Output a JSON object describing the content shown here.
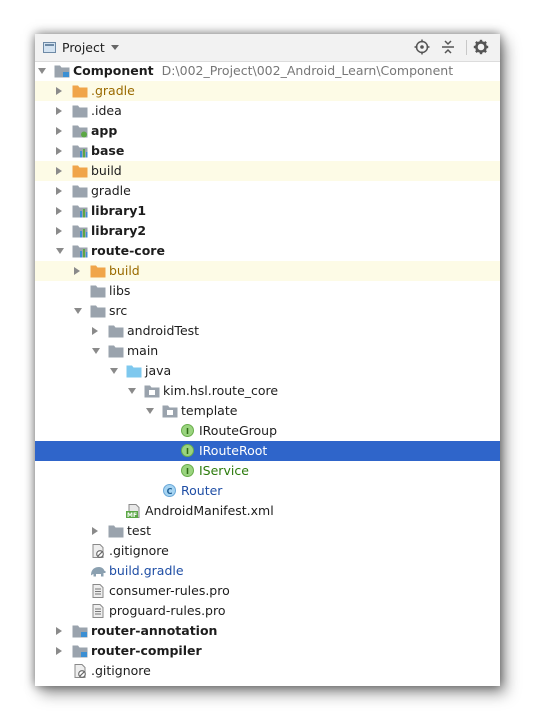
{
  "header": {
    "title": "Project",
    "buttons": [
      "locate-icon",
      "collapse-icon",
      "settings-icon"
    ]
  },
  "tree": [
    {
      "label": "Component",
      "path": "D:\\002_Project\\002_Android_Learn\\Component",
      "bold": true
    },
    {
      "label": ".gradle"
    },
    {
      "label": ".idea"
    },
    {
      "label": "app",
      "bold": true
    },
    {
      "label": "base",
      "bold": true
    },
    {
      "label": "build"
    },
    {
      "label": "gradle"
    },
    {
      "label": "library1",
      "bold": true
    },
    {
      "label": "library2",
      "bold": true
    },
    {
      "label": "route-core",
      "bold": true
    },
    {
      "label": "build"
    },
    {
      "label": "libs"
    },
    {
      "label": "src"
    },
    {
      "label": "androidTest"
    },
    {
      "label": "main"
    },
    {
      "label": "java"
    },
    {
      "label": "kim.hsl.route_core"
    },
    {
      "label": "template"
    },
    {
      "label": "IRouteGroup"
    },
    {
      "label": "IRouteRoot"
    },
    {
      "label": "IService"
    },
    {
      "label": "Router"
    },
    {
      "label": "AndroidManifest.xml"
    },
    {
      "label": "test"
    },
    {
      "label": ".gitignore"
    },
    {
      "label": "build.gradle"
    },
    {
      "label": "consumer-rules.pro"
    },
    {
      "label": "proguard-rules.pro"
    },
    {
      "label": "router-annotation",
      "bold": true
    },
    {
      "label": "router-compiler",
      "bold": true
    },
    {
      "label": ".gitignore"
    }
  ],
  "colors": {
    "selection": "#2f65ca",
    "highlight_row": "#fdfbe6",
    "excluded_folder": "#f0a54a",
    "folder": "#9aa3ad",
    "source_folder": "#7ec8ee"
  }
}
